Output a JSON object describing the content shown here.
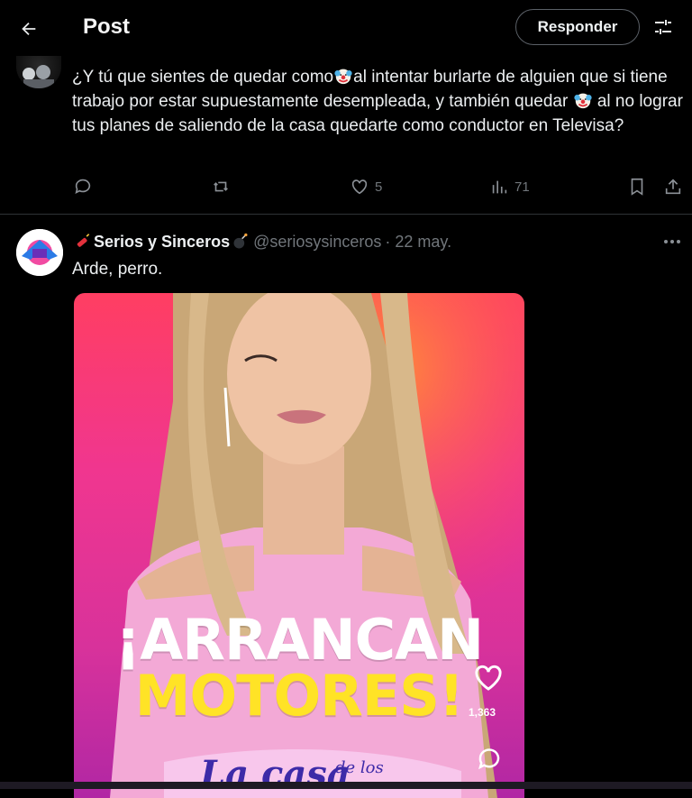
{
  "header": {
    "title": "Post",
    "reply_button": "Responder"
  },
  "reply": {
    "text_parts": [
      "¿Y tú que sientes de quedar como",
      "al intentar burlarte de alguien que si tiene trabajo por estar supuestamente desempleada, y también quedar",
      "al no lograr tus planes de saliendo de la casa quedarte como conductor en Televisa?"
    ],
    "emoji": "clown-face",
    "actions": {
      "likes": "5",
      "views": "71"
    }
  },
  "post": {
    "display_name": "Serios y Sinceros",
    "handle": "@seriosysinceros",
    "date": "· 22 may.",
    "text": "Arde, perro.",
    "media": {
      "headline_1": "¡ARRANCAN",
      "headline_2": "MOTORES!",
      "like_count": "1,363",
      "brand": "La casa",
      "brand_small": "de los"
    }
  },
  "colors": {
    "background": "#000000",
    "text": "#e7e9ea",
    "muted": "#71767b",
    "divider": "#2f3336",
    "headline_yellow": "#ffe326"
  }
}
